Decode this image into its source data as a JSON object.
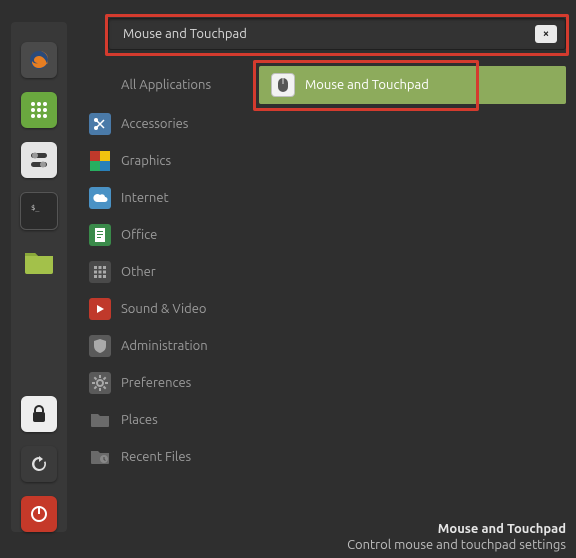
{
  "launcher": {
    "items": [
      {
        "name": "firefox",
        "bg": "#4a4a4a"
      },
      {
        "name": "apps-grid",
        "bg": "#6aa83f"
      },
      {
        "name": "settings-toggles",
        "bg": "#e5e5e5"
      },
      {
        "name": "terminal",
        "bg": "#2b2b2b"
      },
      {
        "name": "files",
        "bg": "#a3c14a"
      }
    ],
    "bottom": [
      {
        "name": "lock",
        "bg": "#eeeeee"
      },
      {
        "name": "refresh",
        "bg": "#3b3b3b"
      },
      {
        "name": "power",
        "bg": "#c53929"
      }
    ]
  },
  "search": {
    "value": "Mouse and Touchpad",
    "clear_symbol": "×"
  },
  "categories": {
    "heading": "All Applications",
    "items": [
      {
        "label": "Accessories",
        "icon": "scissors",
        "bg": "#4a7aa8"
      },
      {
        "label": "Graphics",
        "icon": "swatch",
        "bg": "#222"
      },
      {
        "label": "Internet",
        "icon": "cloud",
        "bg": "#4a92c5"
      },
      {
        "label": "Office",
        "icon": "doc",
        "bg": "#3a8a4a"
      },
      {
        "label": "Other",
        "icon": "grid",
        "bg": "#4a4a4a"
      },
      {
        "label": "Sound & Video",
        "icon": "play",
        "bg": "#c0392b"
      },
      {
        "label": "Administration",
        "icon": "shield",
        "bg": "#5a5a5a"
      },
      {
        "label": "Preferences",
        "icon": "gear",
        "bg": "#5a5a5a"
      },
      {
        "label": "Places",
        "icon": "folder",
        "bg": "#5a5a5a"
      },
      {
        "label": "Recent Files",
        "icon": "clock-folder",
        "bg": "#5a5a5a"
      }
    ]
  },
  "results": [
    {
      "label": "Mouse and Touchpad"
    }
  ],
  "tooltip": {
    "title": "Mouse and Touchpad",
    "subtitle": "Control mouse and touchpad settings"
  }
}
